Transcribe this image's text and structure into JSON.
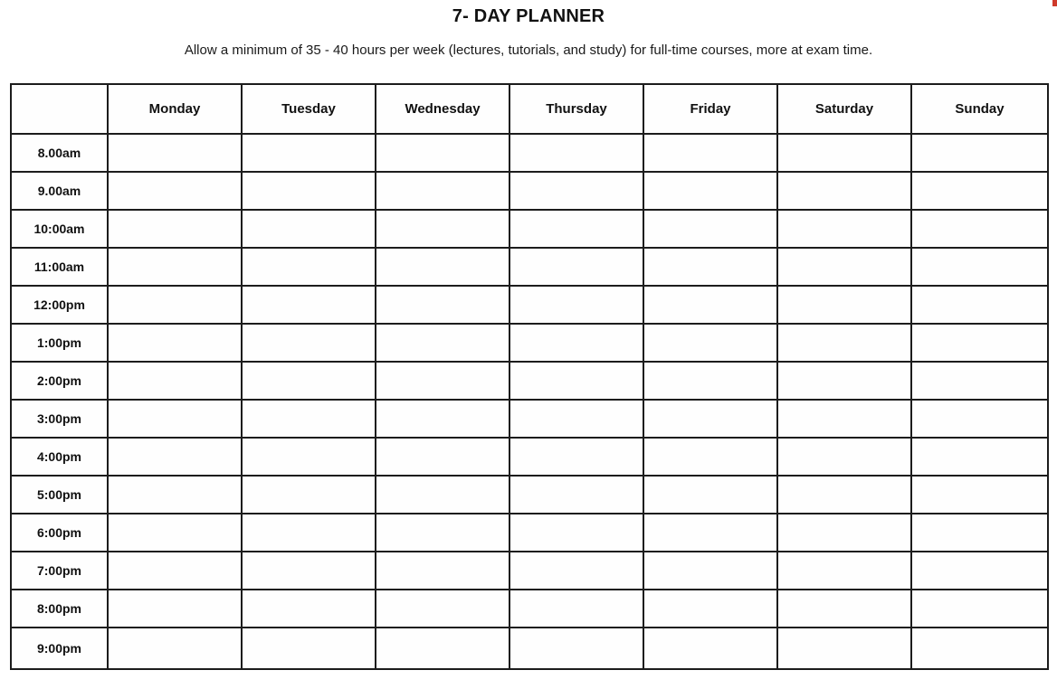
{
  "header": {
    "title": "7- DAY PLANNER",
    "subtitle": "Allow a minimum of 35 - 40 hours per week (lectures, tutorials, and study) for full-time courses, more at exam time."
  },
  "planner": {
    "corner_label": "",
    "day_columns": [
      "Monday",
      "Tuesday",
      "Wednesday",
      "Thursday",
      "Friday",
      "Saturday",
      "Sunday"
    ],
    "time_rows": [
      "8.00am",
      "9.00am",
      "10:00am",
      "11:00am",
      "12:00pm",
      "1:00pm",
      "2:00pm",
      "3:00pm",
      "4:00pm",
      "5:00pm",
      "6:00pm",
      "7:00pm",
      "8:00pm",
      "9:00pm"
    ],
    "cells": [
      [
        "",
        "",
        "",
        "",
        "",
        "",
        ""
      ],
      [
        "",
        "",
        "",
        "",
        "",
        "",
        ""
      ],
      [
        "",
        "",
        "",
        "",
        "",
        "",
        ""
      ],
      [
        "",
        "",
        "",
        "",
        "",
        "",
        ""
      ],
      [
        "",
        "",
        "",
        "",
        "",
        "",
        ""
      ],
      [
        "",
        "",
        "",
        "",
        "",
        "",
        ""
      ],
      [
        "",
        "",
        "",
        "",
        "",
        "",
        ""
      ],
      [
        "",
        "",
        "",
        "",
        "",
        "",
        ""
      ],
      [
        "",
        "",
        "",
        "",
        "",
        "",
        ""
      ],
      [
        "",
        "",
        "",
        "",
        "",
        "",
        ""
      ],
      [
        "",
        "",
        "",
        "",
        "",
        "",
        ""
      ],
      [
        "",
        "",
        "",
        "",
        "",
        "",
        ""
      ],
      [
        "",
        "",
        "",
        "",
        "",
        "",
        ""
      ],
      [
        "",
        "",
        "",
        "",
        "",
        "",
        ""
      ]
    ]
  },
  "colors": {
    "border": "#1c1c1c",
    "text": "#111111",
    "cell_background": "#fefefe",
    "page_background": "#ffffff",
    "corner_mark": "#cf3a2b"
  }
}
